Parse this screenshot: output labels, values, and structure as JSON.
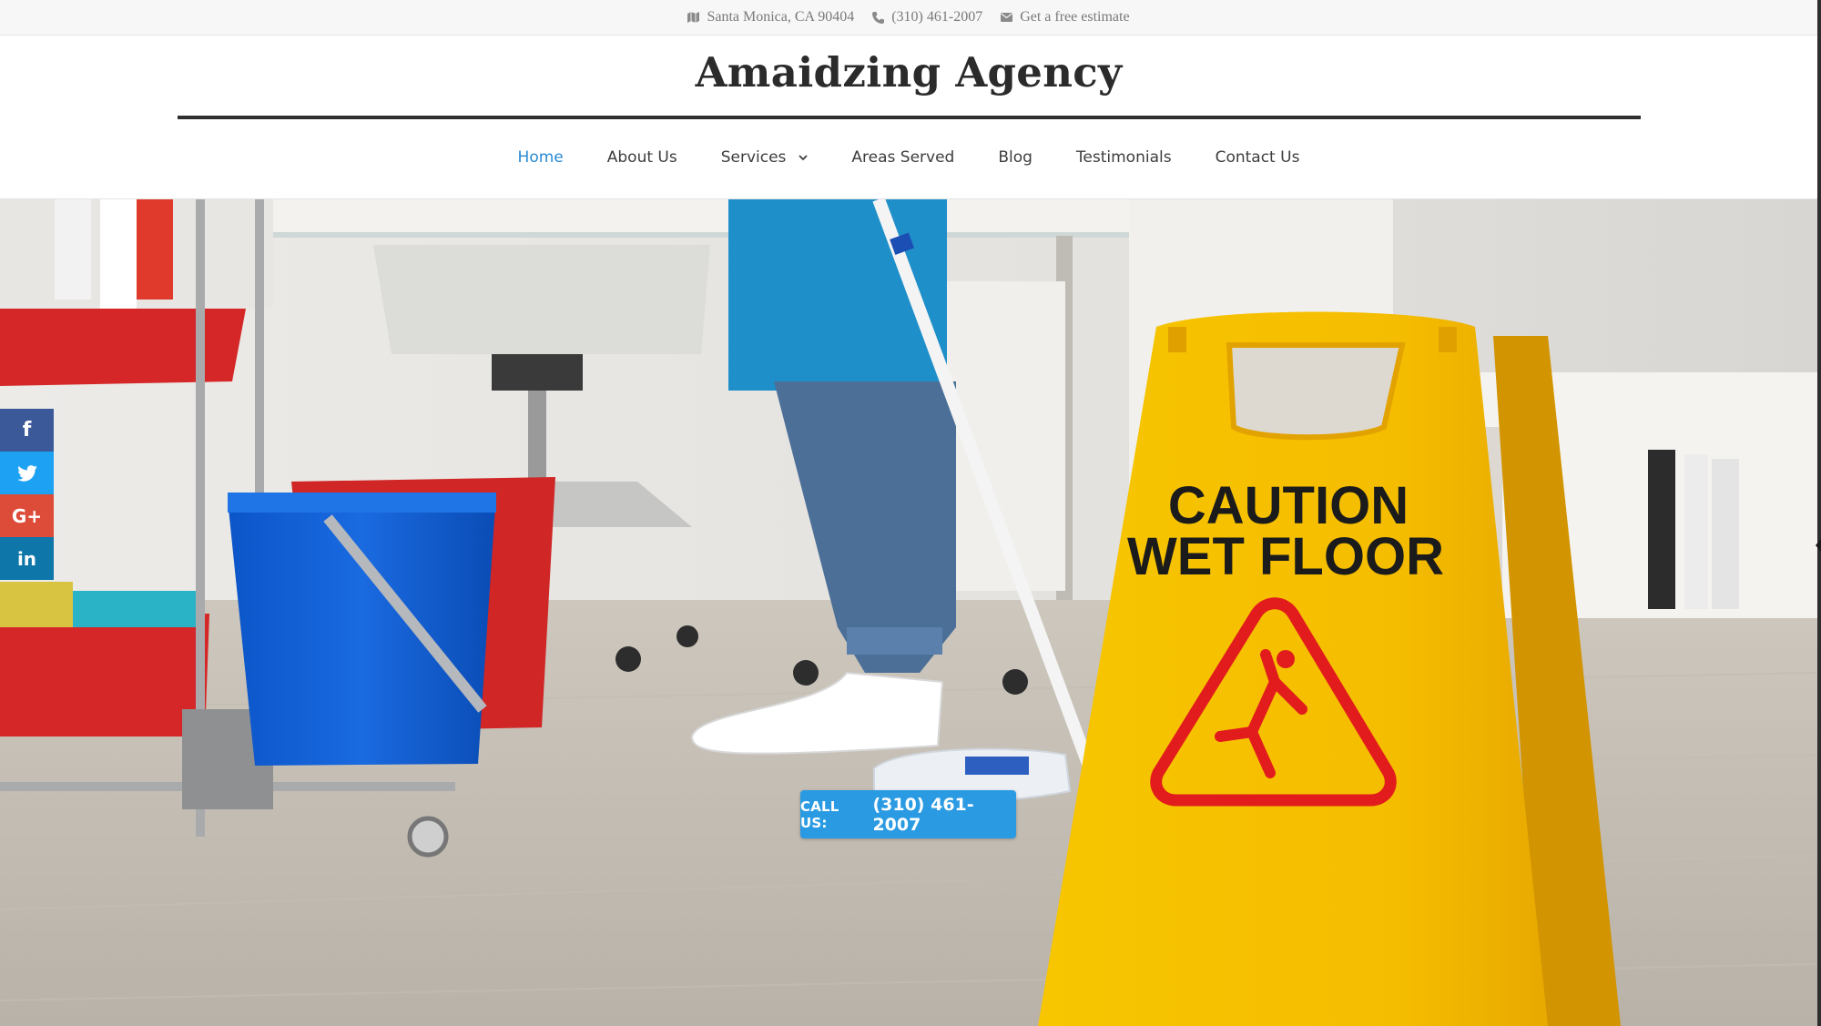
{
  "topbar": {
    "address": "Santa Monica, CA 90404",
    "phone": "(310) 461-2007",
    "estimate": "Get a free estimate"
  },
  "header": {
    "site_title": "Amaidzing Agency"
  },
  "nav": {
    "items": [
      {
        "label": "Home",
        "active": true
      },
      {
        "label": "About Us"
      },
      {
        "label": "Services",
        "has_dropdown": true
      },
      {
        "label": "Areas Served"
      },
      {
        "label": "Blog"
      },
      {
        "label": "Testimonials"
      },
      {
        "label": "Contact Us"
      }
    ]
  },
  "hero": {
    "cta_label": "CALL US:",
    "cta_phone": "(310) 461-2007",
    "sign_line1": "CAUTION",
    "sign_line2": "WET FLOOR"
  },
  "social": {
    "icons": [
      "facebook-icon",
      "twitter-icon",
      "google-plus-icon",
      "linkedin-icon"
    ],
    "facebook": "f",
    "googleplus": "G+",
    "linkedin": "in"
  },
  "colors": {
    "accent": "#2a9be3",
    "nav_active": "#2a8ad4",
    "facebook": "#3b5998",
    "twitter": "#1da1f2",
    "googleplus": "#dd4b39",
    "linkedin": "#0e76a8",
    "sign_yellow": "#f5c000"
  }
}
